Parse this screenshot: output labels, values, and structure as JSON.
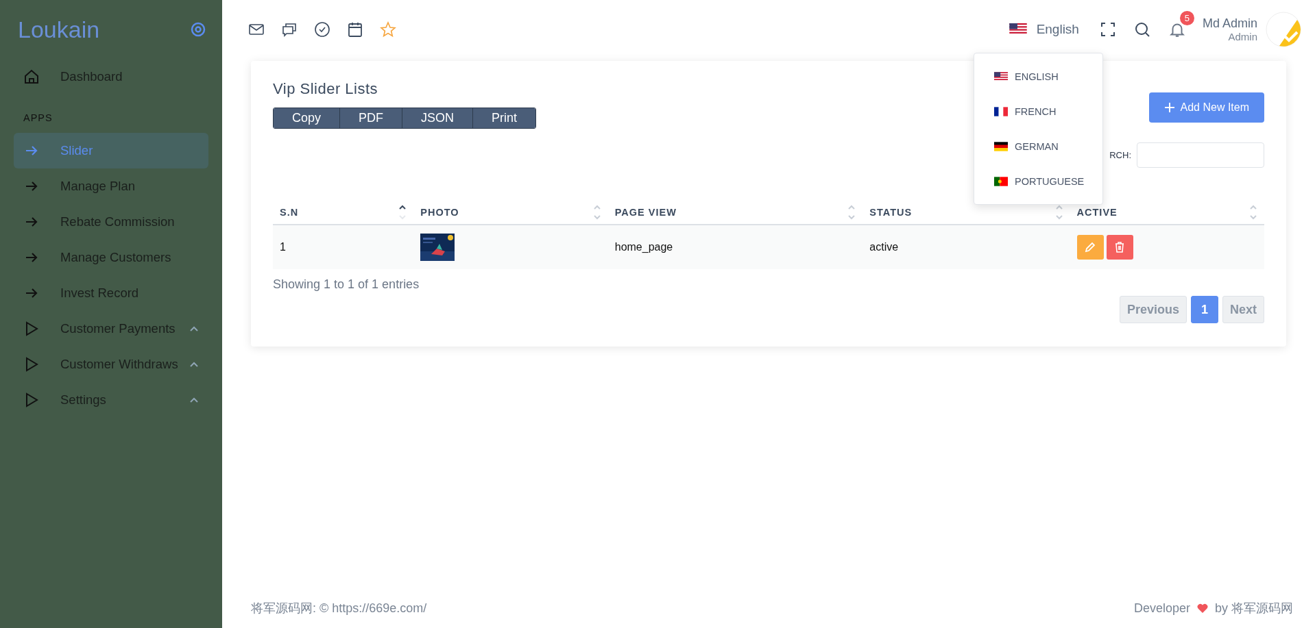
{
  "sidebar": {
    "brand": "Loukain",
    "items": [
      {
        "label": "Dashboard",
        "kind": "home",
        "selected": false
      },
      {
        "section": "APPS"
      },
      {
        "label": "Slider",
        "kind": "arrow",
        "selected": true
      },
      {
        "label": "Manage Plan",
        "kind": "arrow",
        "selected": false
      },
      {
        "label": "Rebate Commission",
        "kind": "arrow",
        "selected": false
      },
      {
        "label": "Manage Customers",
        "kind": "arrow",
        "selected": false
      },
      {
        "label": "Invest Record",
        "kind": "arrow",
        "selected": false
      },
      {
        "label": "Customer Payments",
        "kind": "group",
        "selected": false
      },
      {
        "label": "Customer Withdraws",
        "kind": "group",
        "selected": false
      },
      {
        "label": "Settings",
        "kind": "group",
        "selected": false
      }
    ]
  },
  "header": {
    "language": "English",
    "notifications": "5",
    "user_name": "Md Admin",
    "user_role": "Admin",
    "language_menu": [
      {
        "label": "ENGLISH",
        "kind": "us"
      },
      {
        "label": "FRENCH",
        "kind": "fr"
      },
      {
        "label": "GERMAN",
        "kind": "de"
      },
      {
        "label": "PORTUGUESE",
        "kind": "pt"
      }
    ]
  },
  "card": {
    "title": "Vip Slider Lists",
    "export_buttons": [
      "Copy",
      "PDF",
      "JSON",
      "Print"
    ],
    "add_button": "Add New Item",
    "search_label": "RCH:",
    "table": {
      "columns": [
        {
          "label": "S.N",
          "sorted": true
        },
        {
          "label": "PHOTO",
          "sorted": false
        },
        {
          "label": "PAGE VIEW",
          "sorted": false
        },
        {
          "label": "STATUS",
          "sorted": false
        },
        {
          "label": "ACTIVE",
          "sorted": false
        }
      ],
      "rows": [
        {
          "sn": "1",
          "page_view": "home_page",
          "status": "active"
        }
      ]
    },
    "info": "Showing 1 to 1 of 1 entries",
    "pagination": [
      {
        "label": "Previous",
        "selected": false
      },
      {
        "label": "1",
        "selected": true
      },
      {
        "label": "Next",
        "selected": false
      }
    ]
  },
  "footer": {
    "left": "将军源码网: © https://669e.com/",
    "developer": "Developer",
    "by": "by 将军源码网"
  }
}
